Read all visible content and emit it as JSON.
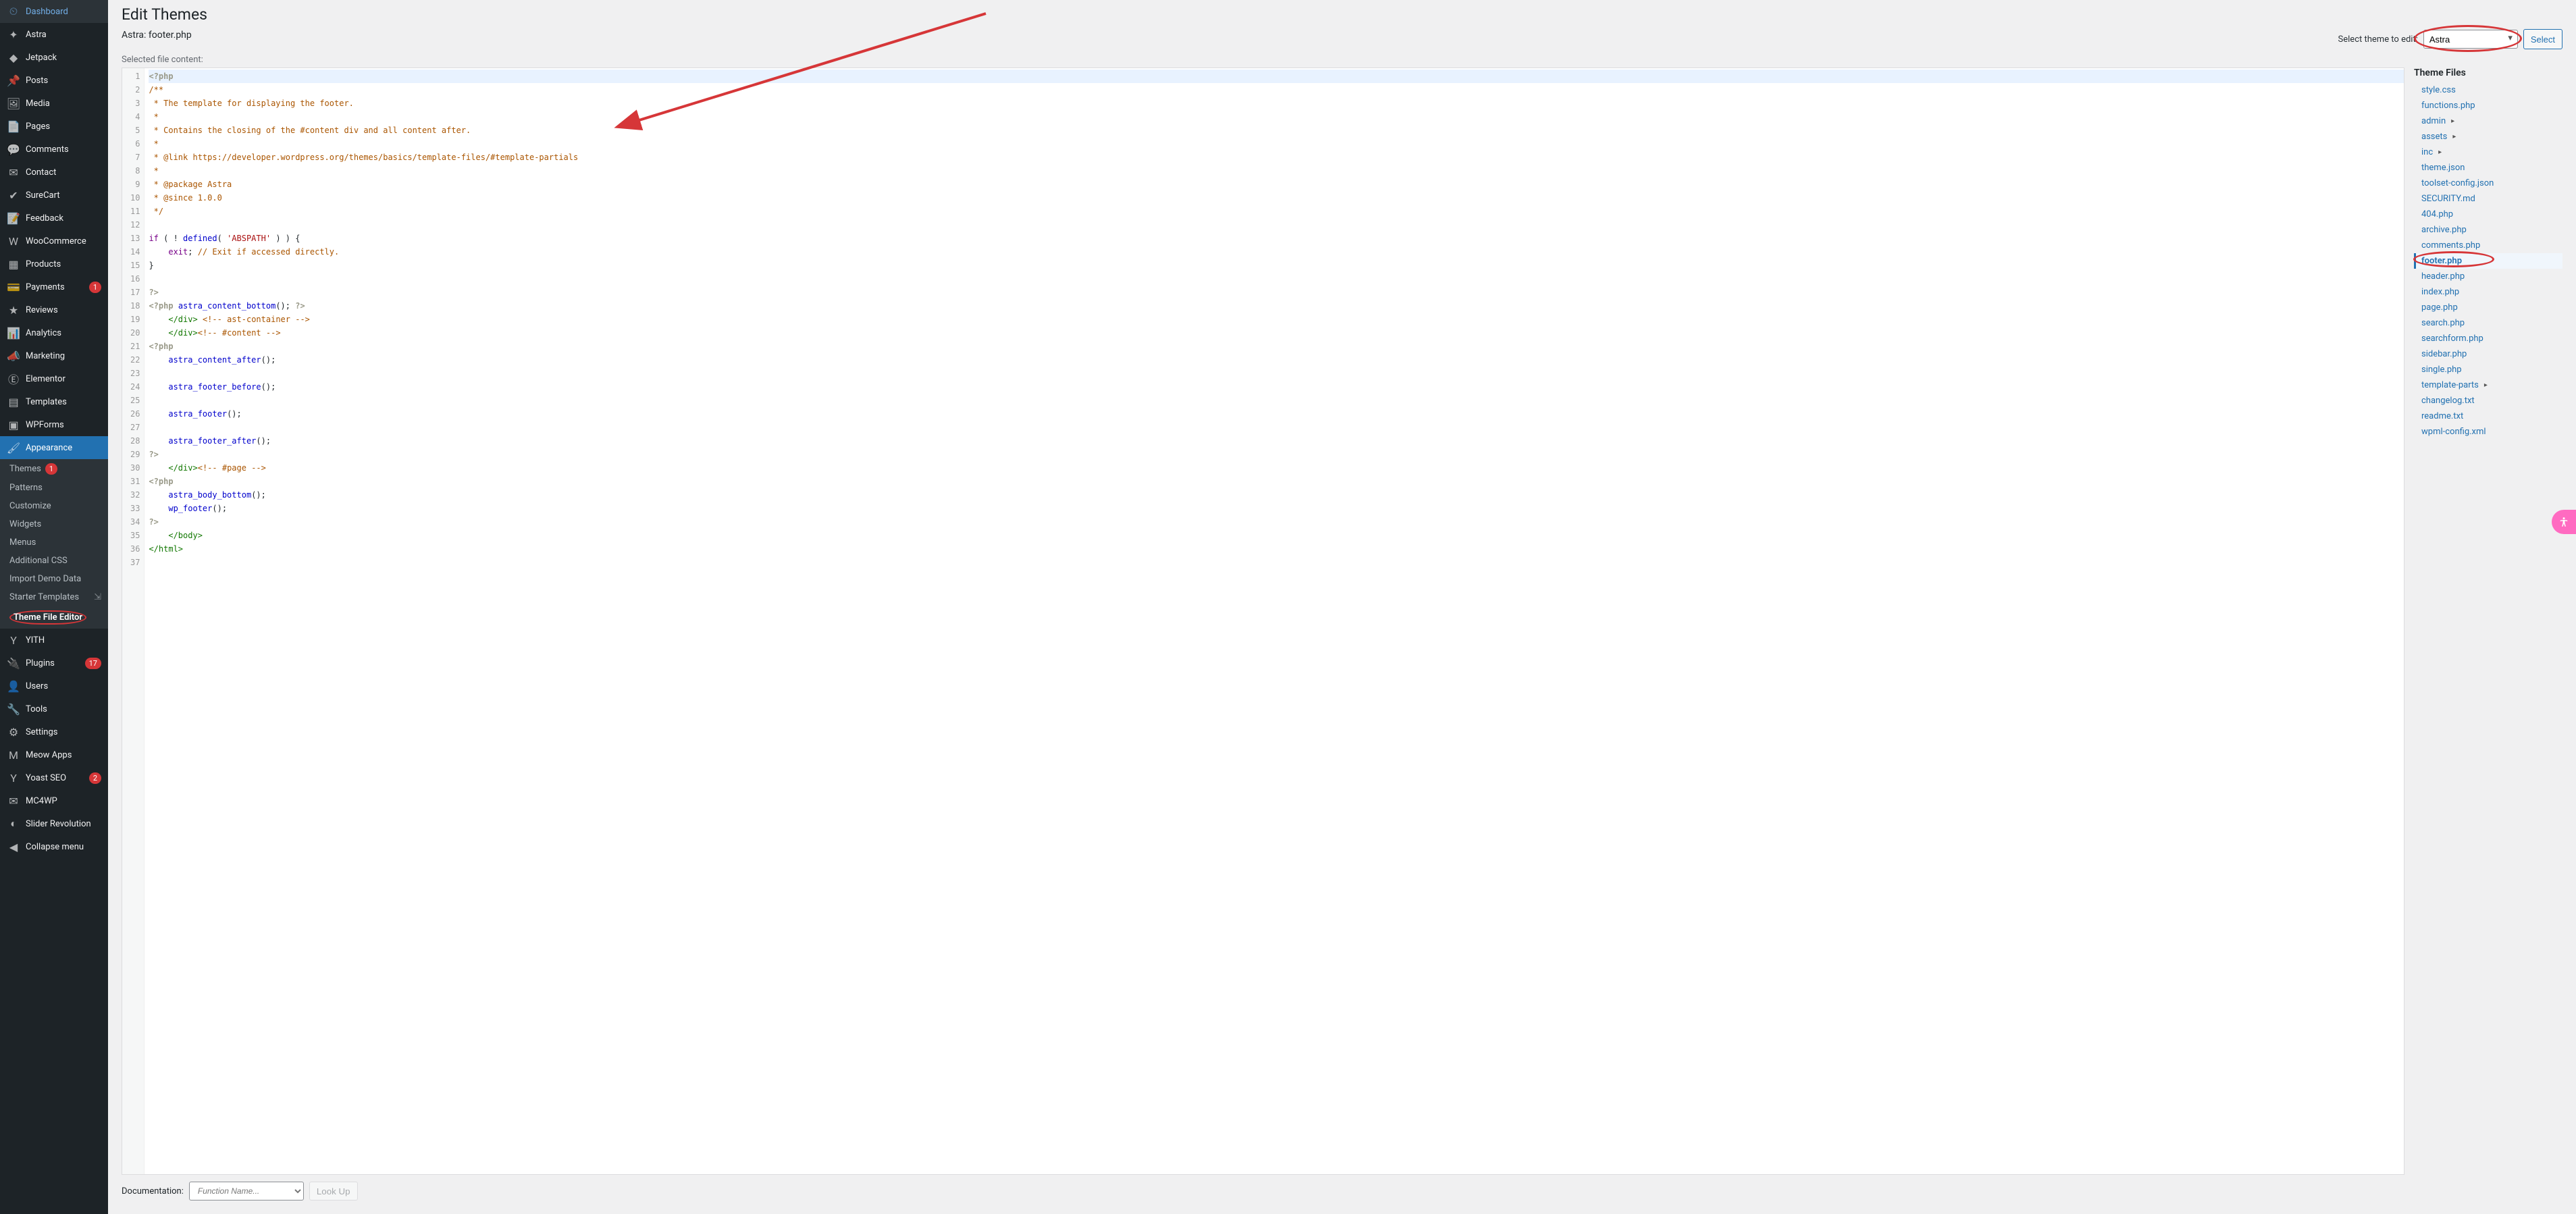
{
  "sidebar": {
    "items": [
      {
        "label": "Dashboard",
        "icon": "dashboard"
      },
      {
        "label": "Astra",
        "icon": "astra"
      },
      {
        "label": "Jetpack",
        "icon": "jetpack"
      },
      {
        "label": "Posts",
        "icon": "posts"
      },
      {
        "label": "Media",
        "icon": "media"
      },
      {
        "label": "Pages",
        "icon": "pages"
      },
      {
        "label": "Comments",
        "icon": "comments"
      },
      {
        "label": "Contact",
        "icon": "contact"
      },
      {
        "label": "SureCart",
        "icon": "surecart"
      },
      {
        "label": "Feedback",
        "icon": "feedback"
      },
      {
        "label": "WooCommerce",
        "icon": "woo"
      },
      {
        "label": "Products",
        "icon": "products"
      },
      {
        "label": "Payments",
        "icon": "payments",
        "badge": "1"
      },
      {
        "label": "Reviews",
        "icon": "reviews"
      },
      {
        "label": "Analytics",
        "icon": "analytics"
      },
      {
        "label": "Marketing",
        "icon": "marketing"
      },
      {
        "label": "Elementor",
        "icon": "elementor"
      },
      {
        "label": "Templates",
        "icon": "templates"
      },
      {
        "label": "WPForms",
        "icon": "wpforms"
      },
      {
        "label": "Appearance",
        "icon": "appearance",
        "active": true
      },
      {
        "label": "YITH",
        "icon": "yith"
      },
      {
        "label": "Plugins",
        "icon": "plugins",
        "badge": "17"
      },
      {
        "label": "Users",
        "icon": "users"
      },
      {
        "label": "Tools",
        "icon": "tools"
      },
      {
        "label": "Settings",
        "icon": "settings"
      },
      {
        "label": "Meow Apps",
        "icon": "meow"
      },
      {
        "label": "Yoast SEO",
        "icon": "yoast",
        "badge": "2"
      },
      {
        "label": "MC4WP",
        "icon": "mc4wp"
      },
      {
        "label": "Slider Revolution",
        "icon": "slider"
      },
      {
        "label": "Collapse menu",
        "icon": "collapse"
      }
    ],
    "appearance_submenu": [
      {
        "label": "Themes",
        "badge": "1"
      },
      {
        "label": "Patterns"
      },
      {
        "label": "Customize"
      },
      {
        "label": "Widgets"
      },
      {
        "label": "Menus"
      },
      {
        "label": "Additional CSS"
      },
      {
        "label": "Import Demo Data"
      },
      {
        "label": "Starter Templates",
        "extra_icon": true
      },
      {
        "label": "Theme File Editor",
        "current": true,
        "circled": true
      }
    ]
  },
  "header": {
    "page_title": "Edit Themes",
    "current_file": "Astra: footer.php",
    "selected_content_label": "Selected file content:",
    "select_theme_label": "Select theme to edit:",
    "selected_theme": "Astra",
    "select_button": "Select"
  },
  "code": {
    "lines": [
      {
        "n": 1,
        "html": "<span class='tok-php'>&lt;?php</span>",
        "active": true
      },
      {
        "n": 2,
        "html": "<span class='tok-com'>/**</span>"
      },
      {
        "n": 3,
        "html": "<span class='tok-com'> * The template for displaying the footer.</span>"
      },
      {
        "n": 4,
        "html": "<span class='tok-com'> *</span>"
      },
      {
        "n": 5,
        "html": "<span class='tok-com'> * Contains the closing of the #content div and all content after.</span>"
      },
      {
        "n": 6,
        "html": "<span class='tok-com'> *</span>"
      },
      {
        "n": 7,
        "html": "<span class='tok-com'> * @link https://developer.wordpress.org/themes/basics/template-files/#template-partials</span>"
      },
      {
        "n": 8,
        "html": "<span class='tok-com'> *</span>"
      },
      {
        "n": 9,
        "html": "<span class='tok-com'> * @package Astra</span>"
      },
      {
        "n": 10,
        "html": "<span class='tok-com'> * @since 1.0.0</span>"
      },
      {
        "n": 11,
        "html": "<span class='tok-com'> */</span>"
      },
      {
        "n": 12,
        "html": ""
      },
      {
        "n": 13,
        "html": "<span class='tok-kw'>if</span> ( ! <span class='tok-fn'>defined</span>( <span class='tok-str'>'ABSPATH'</span> ) ) {"
      },
      {
        "n": 14,
        "html": "    <span class='tok-kw'>exit</span>; <span class='tok-com'>// Exit if accessed directly.</span>"
      },
      {
        "n": 15,
        "html": "}"
      },
      {
        "n": 16,
        "html": ""
      },
      {
        "n": 17,
        "html": "<span class='tok-php'>?&gt;</span>"
      },
      {
        "n": 18,
        "html": "<span class='tok-php'>&lt;?php</span> <span class='tok-fn'>astra_content_bottom</span>(); <span class='tok-php'>?&gt;</span>"
      },
      {
        "n": 19,
        "html": "    <span class='tok-tag'>&lt;/div&gt;</span> <span class='tok-com'>&lt;!-- ast-container --&gt;</span>"
      },
      {
        "n": 20,
        "html": "    <span class='tok-tag'>&lt;/div&gt;</span><span class='tok-com'>&lt;!-- #content --&gt;</span>"
      },
      {
        "n": 21,
        "html": "<span class='tok-php'>&lt;?php</span>"
      },
      {
        "n": 22,
        "html": "    <span class='tok-fn'>astra_content_after</span>();"
      },
      {
        "n": 23,
        "html": ""
      },
      {
        "n": 24,
        "html": "    <span class='tok-fn'>astra_footer_before</span>();"
      },
      {
        "n": 25,
        "html": ""
      },
      {
        "n": 26,
        "html": "    <span class='tok-fn'>astra_footer</span>();"
      },
      {
        "n": 27,
        "html": ""
      },
      {
        "n": 28,
        "html": "    <span class='tok-fn'>astra_footer_after</span>();"
      },
      {
        "n": 29,
        "html": "<span class='tok-php'>?&gt;</span>"
      },
      {
        "n": 30,
        "html": "    <span class='tok-tag'>&lt;/div&gt;</span><span class='tok-com'>&lt;!-- #page --&gt;</span>"
      },
      {
        "n": 31,
        "html": "<span class='tok-php'>&lt;?php</span>"
      },
      {
        "n": 32,
        "html": "    <span class='tok-fn'>astra_body_bottom</span>();"
      },
      {
        "n": 33,
        "html": "    <span class='tok-fn'>wp_footer</span>();"
      },
      {
        "n": 34,
        "html": "<span class='tok-php'>?&gt;</span>"
      },
      {
        "n": 35,
        "html": "    <span class='tok-tag'>&lt;/body&gt;</span>"
      },
      {
        "n": 36,
        "html": "<span class='tok-tag'>&lt;/html&gt;</span>"
      },
      {
        "n": 37,
        "html": ""
      }
    ]
  },
  "files": {
    "heading": "Theme Files",
    "items": [
      {
        "label": "style.css"
      },
      {
        "label": "functions.php"
      },
      {
        "label": "admin",
        "folder": true
      },
      {
        "label": "assets",
        "folder": true
      },
      {
        "label": "inc",
        "folder": true
      },
      {
        "label": "theme.json"
      },
      {
        "label": "toolset-config.json"
      },
      {
        "label": "SECURITY.md"
      },
      {
        "label": "404.php"
      },
      {
        "label": "archive.php"
      },
      {
        "label": "comments.php"
      },
      {
        "label": "footer.php",
        "current": true,
        "circled": true
      },
      {
        "label": "header.php"
      },
      {
        "label": "index.php"
      },
      {
        "label": "page.php"
      },
      {
        "label": "search.php"
      },
      {
        "label": "searchform.php"
      },
      {
        "label": "sidebar.php"
      },
      {
        "label": "single.php"
      },
      {
        "label": "template-parts",
        "folder": true
      },
      {
        "label": "changelog.txt"
      },
      {
        "label": "readme.txt"
      },
      {
        "label": "wpml-config.xml"
      }
    ]
  },
  "footer": {
    "doc_label": "Documentation:",
    "doc_placeholder": "Function Name...",
    "lookup_label": "Look Up"
  }
}
